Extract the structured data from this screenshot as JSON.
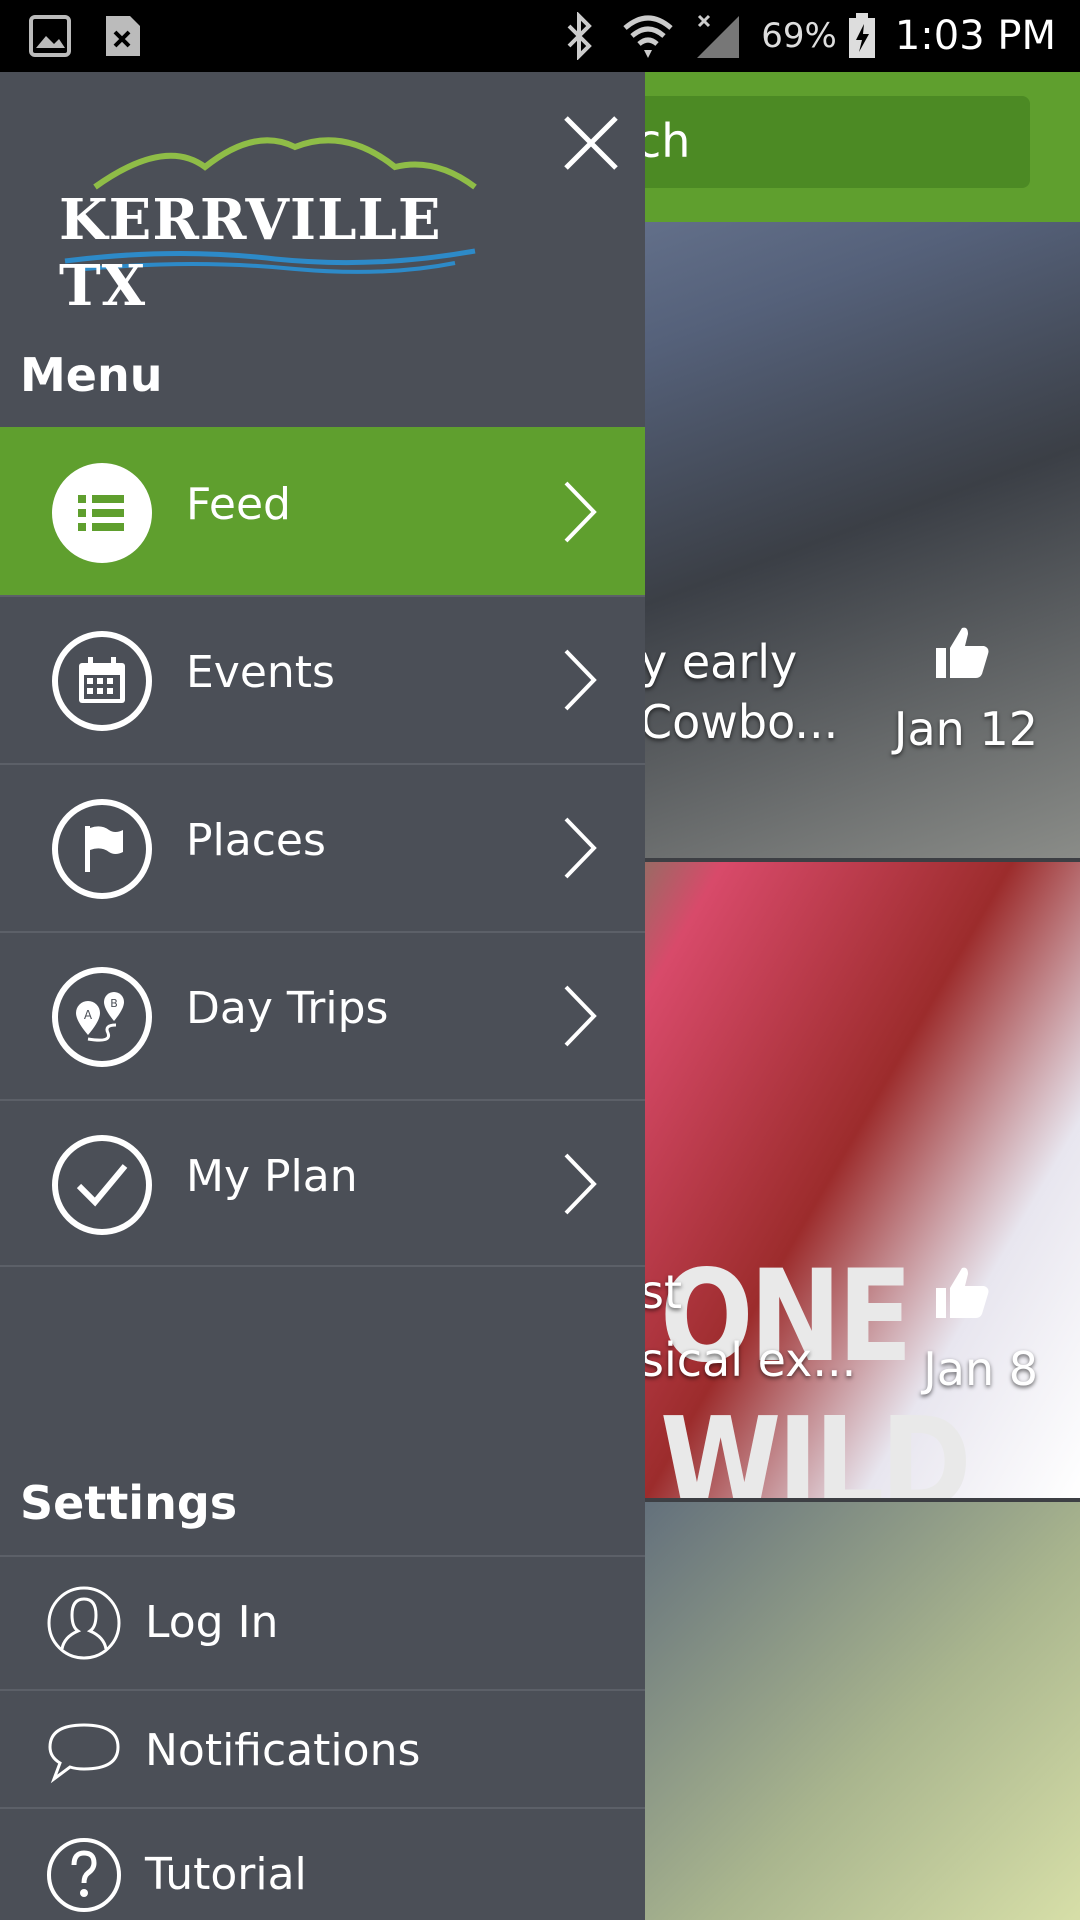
{
  "status_bar": {
    "battery": "69%",
    "time": "1:03 PM",
    "icons": [
      "image-icon",
      "file-x-icon",
      "bluetooth-icon",
      "wifi-icon",
      "signal-icon",
      "battery-charging-icon"
    ]
  },
  "background": {
    "search_partial": "ch",
    "cards": [
      {
        "caption_line1": "y early",
        "caption_line2": "Cowbo...",
        "date": "Jan 12"
      },
      {
        "caption_line1": "st",
        "caption_line2": "sical ex...",
        "date": "Jan 8",
        "poster_text": "ONE WILD"
      },
      {
        "caption_line1": "",
        "caption_line2": "",
        "date": ""
      }
    ]
  },
  "drawer": {
    "logo_text": "KERRVILLE TX",
    "menu_title": "Menu",
    "menu_items": [
      {
        "label": "Feed",
        "icon": "list-icon",
        "active": true
      },
      {
        "label": "Events",
        "icon": "calendar-icon",
        "active": false
      },
      {
        "label": "Places",
        "icon": "flag-icon",
        "active": false
      },
      {
        "label": "Day Trips",
        "icon": "route-icon",
        "active": false
      },
      {
        "label": "My Plan",
        "icon": "check-icon",
        "active": false
      }
    ],
    "settings_title": "Settings",
    "settings_items": [
      {
        "label": "Log In",
        "icon": "user-icon"
      },
      {
        "label": "Notifications",
        "icon": "chat-bubble-icon"
      },
      {
        "label": "Tutorial",
        "icon": "help-icon"
      }
    ]
  },
  "colors": {
    "accent": "#5f9f2e",
    "drawer_bg": "#4b4f57",
    "divider": "#5c6068"
  }
}
